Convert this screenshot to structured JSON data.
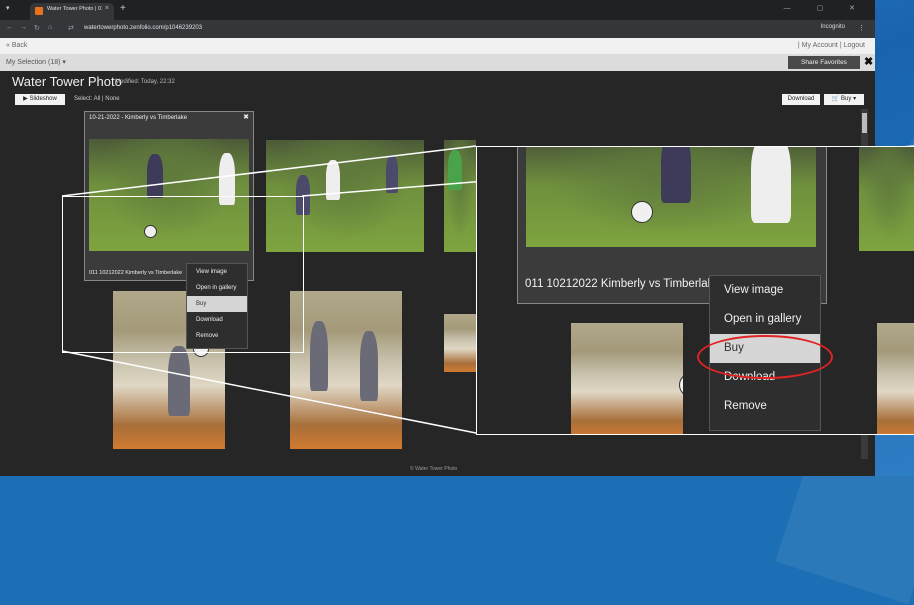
{
  "browser": {
    "tab_title": "Water Tower Photo | 01-18-20...",
    "tab_close": "×",
    "new_tab": "+",
    "url": "watertowerphoto.zenfolio.com/p1046239203",
    "incognito_label": "Incognito",
    "window_controls": "— ▢ ✕"
  },
  "page": {
    "back_link": "« Back",
    "account_links": "| My Account | Logout",
    "my_selection": "My Selection (18) ▾",
    "share_favorites": "Share Favorites",
    "close_icon": "✖",
    "title": "Water Tower Photo",
    "modified": "Modified: Today, 22:32",
    "slideshow": "▶  Slideshow",
    "select_text": "Select: All | None",
    "download": "Download",
    "buy": "🛒 Buy ▾",
    "footer": "© Water Tower Photo"
  },
  "card": {
    "title": "10-21-2022 - Kimberly vs Timberlake",
    "close": "✖",
    "caption": "011 10212022 Kimberly vs Timberlake"
  },
  "context_menu": {
    "items": [
      "View image",
      "Open in gallery",
      "Buy",
      "Download",
      "Remove"
    ],
    "highlighted": "Buy"
  },
  "zoom": {
    "caption": "011 10212022 Kimberly vs Timberlake",
    "items": [
      "View image",
      "Open in gallery",
      "Buy",
      "Download",
      "Remove"
    ]
  },
  "colors": {
    "highlight": "#d6d6d6",
    "circle": "#e02424",
    "background": "#1c6fb5"
  }
}
